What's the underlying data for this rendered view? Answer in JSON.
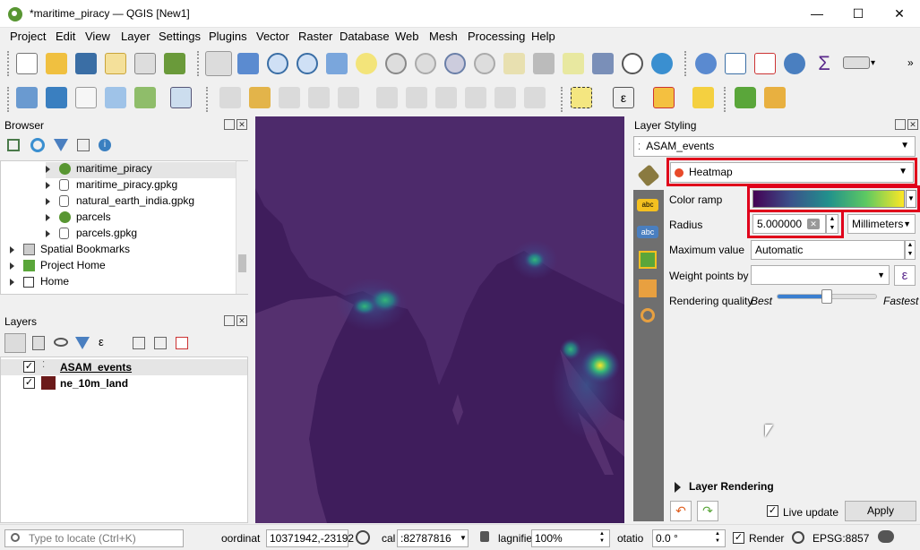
{
  "window": {
    "title": "*maritime_piracy — QGIS [New1]",
    "minimize": "—",
    "maximize": "☐",
    "close": "✕"
  },
  "menubar": {
    "items": [
      "Project",
      "Edit",
      "View",
      "Layer",
      "Settings",
      "Plugins",
      "Vector",
      "Raster",
      "Database",
      "Web",
      "Mesh",
      "Processing",
      "Help"
    ]
  },
  "browser": {
    "title": "Browser",
    "items": [
      {
        "label": "maritime_piracy",
        "icon": "qgis-project-icon"
      },
      {
        "label": "maritime_piracy.gpkg",
        "icon": "database-icon"
      },
      {
        "label": "natural_earth_india.gpkg",
        "icon": "database-icon"
      },
      {
        "label": "parcels",
        "icon": "qgis-project-icon"
      },
      {
        "label": "parcels.gpkg",
        "icon": "database-icon"
      },
      {
        "label": "Spatial Bookmarks",
        "icon": "bookmarks-icon"
      },
      {
        "label": "Project Home",
        "icon": "project-home-icon"
      },
      {
        "label": "Home",
        "icon": "home-icon"
      }
    ]
  },
  "layers": {
    "title": "Layers",
    "items": [
      {
        "label": "ASAM_events",
        "checked": true,
        "bold_underline": true
      },
      {
        "label": "ne_10m_land",
        "checked": true,
        "color": "#6b1a1a"
      }
    ]
  },
  "styling": {
    "title": "Layer Styling",
    "layer_select": "ASAM_events",
    "renderer": "Heatmap",
    "color_ramp_label": "Color ramp",
    "radius_label": "Radius",
    "radius_value": "5.000000",
    "radius_unit": "Millimeters",
    "max_value_label": "Maximum value",
    "max_value": "Automatic",
    "weight_label": "Weight points by",
    "weight_value": "",
    "quality_label": "Rendering quality",
    "quality_best": "Best",
    "quality_fastest": "Fastest",
    "quality_level": 0.5,
    "layer_rendering": "Layer Rendering",
    "live_update": "Live update",
    "live_update_checked": true,
    "apply": "Apply"
  },
  "statusbar": {
    "locate_placeholder": "Type to locate (Ctrl+K)",
    "coord_label": "oordinat",
    "coord_value": "10371942,-23192",
    "scale_label": "cal",
    "scale_value": ":82787816",
    "magnifier_label": "lagnifie",
    "magnifier_value": "100%",
    "rotation_label": "otatio",
    "rotation_value": "0.0 °",
    "render_label": "Render",
    "render_checked": true,
    "crs": "EPSG:8857"
  },
  "colors": {
    "heatmap_low": "#440154",
    "heatmap_high": "#fde725",
    "map_bg": "#3f1d5c",
    "highlight": "#e0001b"
  }
}
